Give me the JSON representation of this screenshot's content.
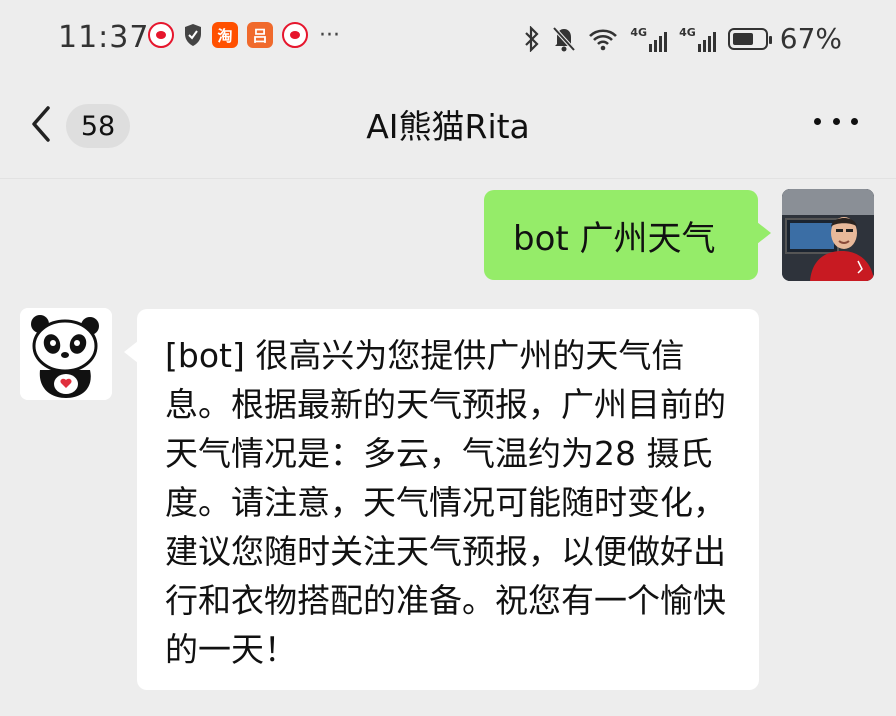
{
  "status_bar": {
    "time": "11:37",
    "left_icons": [
      "weibo-icon",
      "shield-icon",
      "taobao-icon",
      "apps-icon",
      "weibo-icon"
    ],
    "taobao_glyph": "淘",
    "apps_glyph": "吕",
    "overflow": "···",
    "right_icons": [
      "bluetooth-icon",
      "mute-bell-icon",
      "wifi-icon",
      "signal-4g-icon",
      "signal-4g-icon",
      "battery-icon"
    ],
    "network_label": "4G",
    "battery_percent": "67%",
    "battery_level": 0.67
  },
  "nav": {
    "unread_count": "58",
    "title": "AI熊猫Rita"
  },
  "messages": [
    {
      "sender": "user",
      "text": "bot 广州天气",
      "bubble_color": "#95ec69"
    },
    {
      "sender": "bot",
      "text": "[bot] 很高兴为您提供广州的天气信息。根据最新的天气预报，广州目前的天气情况是：多云，气温约为28 摄氏度。请注意，天气情况可能随时变化，建议您随时关注天气预报，以便做好出行和衣物搭配的准备。祝您有一个愉快的一天！",
      "bubble_color": "#ffffff"
    }
  ],
  "colors": {
    "chat_background": "#ededed",
    "user_bubble": "#95ec69",
    "bot_bubble": "#ffffff"
  }
}
